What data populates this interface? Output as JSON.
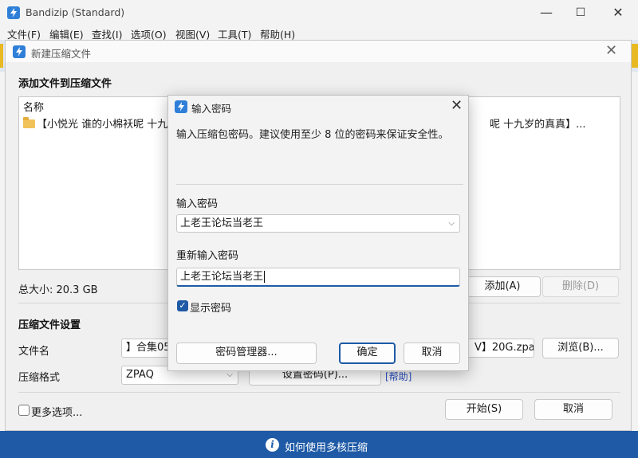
{
  "app": {
    "title": "Bandizip (Standard)"
  },
  "menu": [
    "文件(F)",
    "编辑(E)",
    "查找(I)",
    "选项(O)",
    "视图(V)",
    "工具(T)",
    "帮助(H)"
  ],
  "window_controls": {
    "minimize": "—",
    "maximize": "☐",
    "close": "✕"
  },
  "statusbar": {
    "text": "如何使用多核压缩",
    "icon": "info-icon"
  },
  "new_archive": {
    "title": "新建压缩文件",
    "add_files_section": "添加文件到压缩文件",
    "list_header": "名称",
    "file_name_left": "【小悦光 谁的小棉袄呢 十九岁",
    "file_name_right": "呢  十九岁的真真】...",
    "total_size": "总大小: 20.3 GB",
    "add_button": "添加(A)",
    "delete_button": "删除(D)",
    "settings_section": "压缩文件设置",
    "filename_label": "文件名",
    "filename_value_left": "】合集05",
    "filename_value_right": "V】20G.zpaq",
    "browse_button": "浏览(B)...",
    "format_label": "压缩格式",
    "format_value": "ZPAQ",
    "set_password_button": "设置密码(P)...",
    "help_link": "[帮助]",
    "more_options": "更多选项...",
    "start_button": "开始(S)",
    "cancel_button": "取消"
  },
  "password_dialog": {
    "title": "输入密码",
    "description": "输入压缩包密码。建议使用至少 8 位的密码来保证安全性。",
    "password_label": "输入密码",
    "password_value": "上老王论坛当老王",
    "reenter_label": "重新输入密码",
    "reenter_value": "上老王论坛当老王",
    "show_password": "显示密码",
    "show_password_checked": true,
    "manager_button": "密码管理器...",
    "ok_button": "确定",
    "cancel_button": "取消"
  },
  "colors": {
    "accent": "#1e5aa6",
    "statusbar": "#1e5aa6",
    "folder": "#f2c25a"
  }
}
